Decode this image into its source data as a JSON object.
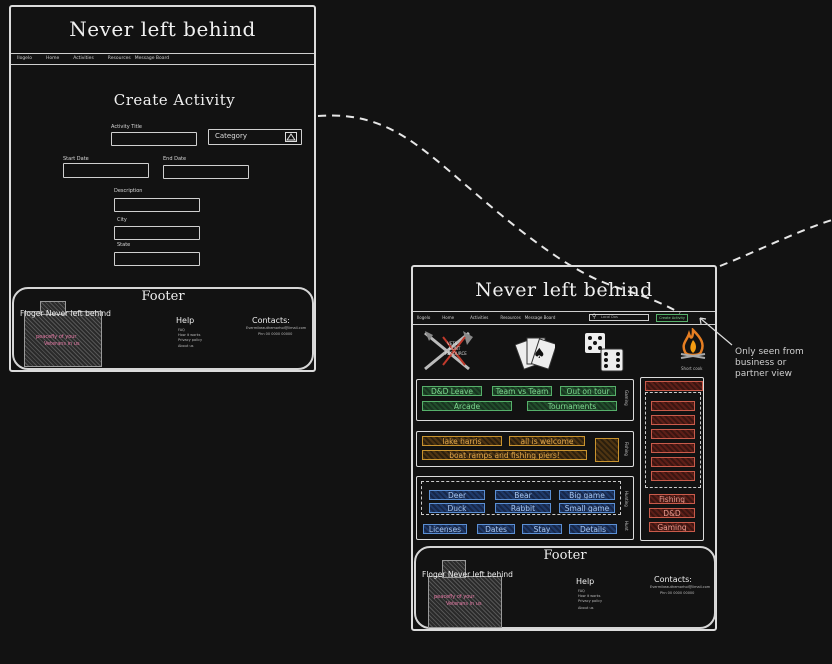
{
  "left_page": {
    "title": "Never left behind",
    "nav": [
      "Ilogelo",
      "Home",
      "Activities",
      "Resources",
      "Message Board"
    ],
    "form_title": "Create Activity",
    "activity_title_label": "Activity Title",
    "category_value": "Category",
    "start_date_label": "Start Date",
    "end_date_label": "End Date",
    "description_label": "Description",
    "city_label": "City",
    "state_label": "State",
    "footer": {
      "title": "Footer",
      "brand": "Floger Never left behind",
      "pink_text": [
        "peacefly of your",
        "Veterans in us"
      ],
      "help_title": "Help",
      "help_items": [
        "FAQ",
        "How it works",
        "Privacy policy",
        "About us"
      ],
      "contacts_title": "Contacts:",
      "contacts_lines": [
        "Evermikeauthemorhol@limail.com",
        "Phn 00 0000 00000"
      ]
    }
  },
  "right_page": {
    "title": "Never left behind",
    "nav": [
      "Ilogelo",
      "Home",
      "Activities",
      "Resources",
      "Message Board"
    ],
    "search_placeholder": "Local Dos",
    "create_button": "Create Activity",
    "icons_caption": "Short cook",
    "graffiti_text": [
      "VETS",
      "HUNT",
      "RESOURCE"
    ],
    "green_tags": [
      "D&D Leave",
      "Team vs Team",
      "Out on tour",
      "Arcade",
      "Tournaments"
    ],
    "green_side_label": "Gaming",
    "orange_tags": [
      "lake harris",
      "all is welcome",
      "boat ramps and fishing piers!"
    ],
    "orange_side_label": "Fishing",
    "blue_tags_top": [
      "Deer",
      "Bear",
      "Big game"
    ],
    "blue_tags_mid": [
      "Duck",
      "Rabbit",
      "Small game"
    ],
    "blue_tags_bottom": [
      "Licenses",
      "Dates",
      "Stay",
      "Details"
    ],
    "blue_side_label": "Hunting",
    "blue_side_label2": "Hunt",
    "red_tags": [
      "Fishing",
      "D&D",
      "Gaming"
    ],
    "footer": {
      "title": "Footer",
      "brand": "Floger Never left behind",
      "pink_text": [
        "peacefly of your",
        "Veterans in us"
      ],
      "help_title": "Help",
      "help_items": [
        "FAQ",
        "How it works",
        "Privacy policy",
        "About us"
      ],
      "contacts_title": "Contacts:",
      "contacts_lines": [
        "Evermikeauthemorhol@limail.com",
        "Phn 00 0000 00000"
      ]
    }
  },
  "annotation": [
    "Only seen from",
    "business or",
    "partner view"
  ],
  "colors": {
    "background": "#121212",
    "green": "#56b06a",
    "orange": "#c8932e",
    "blue": "#5b8fd3",
    "red": "#c95b4b"
  }
}
